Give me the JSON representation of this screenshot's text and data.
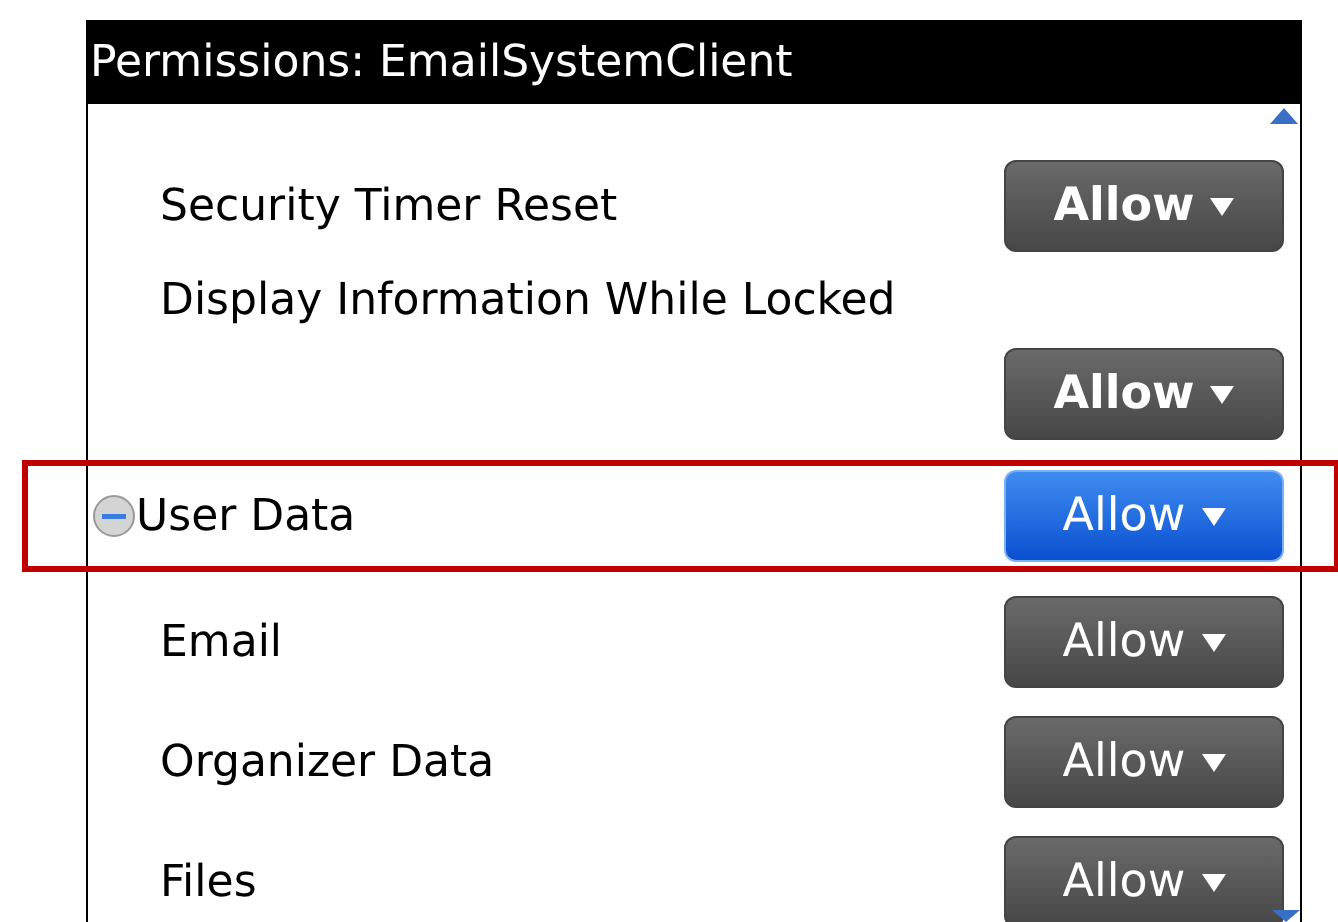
{
  "title": "Permissions: EmailSystemClient",
  "rows": [
    {
      "kind": "setting",
      "label": "Security Timer Reset",
      "value": "Allow",
      "bold": true,
      "focused": false
    },
    {
      "kind": "wrapped",
      "label": "Display Information While Locked",
      "value": "Allow",
      "bold": true,
      "focused": false
    },
    {
      "kind": "group",
      "label": "User Data",
      "value": "Allow",
      "bold": false,
      "focused": true,
      "expanded": true,
      "children": [
        {
          "kind": "setting",
          "label": "Email",
          "value": "Allow",
          "bold": false,
          "focused": false
        },
        {
          "kind": "setting",
          "label": "Organizer Data",
          "value": "Allow",
          "bold": false,
          "focused": false
        },
        {
          "kind": "setting",
          "label": "Files",
          "value": "Allow",
          "bold": false,
          "focused": false
        }
      ]
    }
  ]
}
